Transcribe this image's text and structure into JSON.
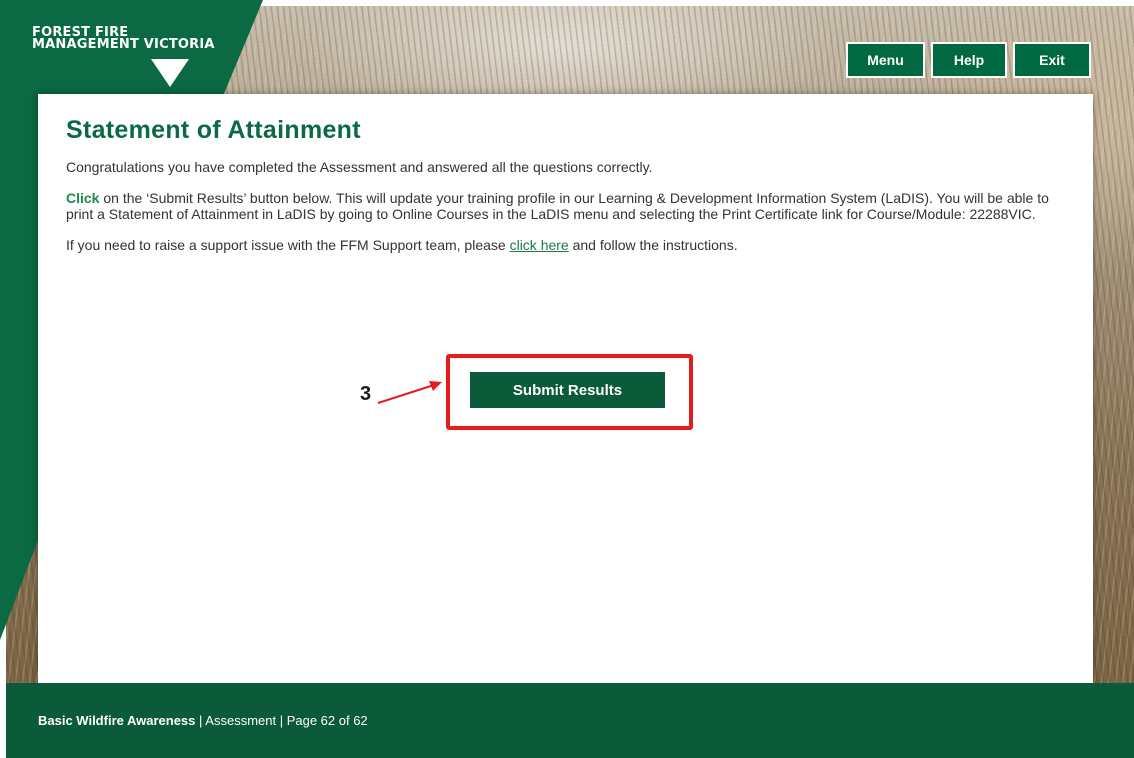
{
  "brand": {
    "line1": "FOREST FIRE",
    "line2_a": "MANAGEMENT ",
    "line2_b": "VICTORIA"
  },
  "nav": {
    "menu": "Menu",
    "help": "Help",
    "exit": "Exit"
  },
  "main": {
    "title": "Statement of Attainment",
    "congrats": "Congratulations you have completed the Assessment and answered all the questions correctly.",
    "instruction_lead": "Click",
    "instruction_rest": " on the ‘Submit Results’ button below. This will update your training profile in our Learning & Development Information System (LaDIS). You will be able to print a Statement of Attainment in LaDIS by going to Online Courses in the LaDIS menu and selecting the Print Certificate link for Course/Module: 22288VIC.",
    "support_pre": "If you need to raise a support issue with the FFM Support team, please ",
    "support_link": "click here",
    "support_post": " and follow the instructions.",
    "submit_label": "Submit Results",
    "annotation_step": "3"
  },
  "footer": {
    "course": "Basic Wildfire Awareness",
    "section": " | Assessment | ",
    "page": "Page 62 of 62"
  },
  "colors": {
    "brand_green": "#0b6a43",
    "button_green": "#006942",
    "footer_green": "#0b5a3a",
    "highlight_red": "#e61b1b"
  }
}
